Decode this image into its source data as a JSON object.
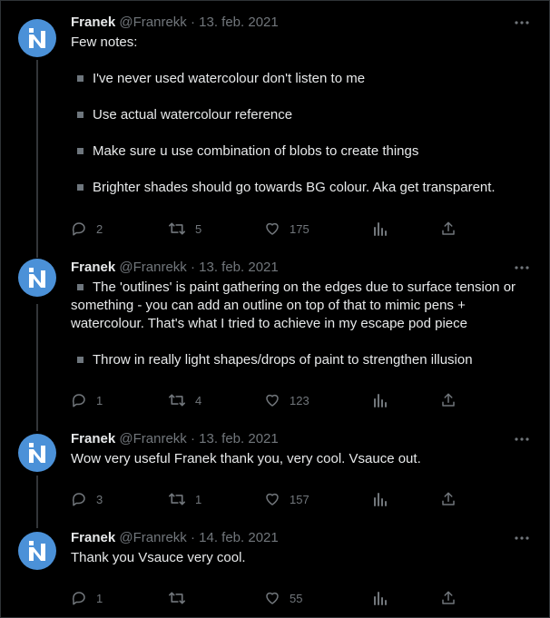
{
  "tweets": [
    {
      "name": "Franek",
      "handle": "@Franrekk",
      "sep": "·",
      "date": "13. feb. 2021",
      "paragraphs": [
        {
          "type": "text",
          "text": "Few notes:"
        },
        {
          "type": "bullet",
          "text": "I've never used watercolour don't listen to me"
        },
        {
          "type": "bullet",
          "text": "Use actual watercolour reference"
        },
        {
          "type": "bullet",
          "text": "Make sure u use combination of blobs to create things"
        },
        {
          "type": "bullet",
          "text": "Brighter shades should go towards BG colour. Aka get transparent."
        }
      ],
      "replies": "2",
      "retweets": "5",
      "likes": "175"
    },
    {
      "name": "Franek",
      "handle": "@Franrekk",
      "sep": "·",
      "date": "13. feb. 2021",
      "paragraphs": [
        {
          "type": "bullet",
          "text": "The 'outlines' is paint gathering on the edges due to surface tension or something - you can add an outline on top of that to mimic pens + watercolour. That's what I tried to achieve in my escape pod piece"
        },
        {
          "type": "bullet",
          "text": "Throw in really light shapes/drops of paint to strengthen illusion"
        }
      ],
      "replies": "1",
      "retweets": "4",
      "likes": "123"
    },
    {
      "name": "Franek",
      "handle": "@Franrekk",
      "sep": "·",
      "date": "13. feb. 2021",
      "paragraphs": [
        {
          "type": "text",
          "text": "Wow very useful Franek thank you, very cool. Vsauce out."
        }
      ],
      "replies": "3",
      "retweets": "1",
      "likes": "157"
    },
    {
      "name": "Franek",
      "handle": "@Franrekk",
      "sep": "·",
      "date": "14. feb. 2021",
      "paragraphs": [
        {
          "type": "text",
          "text": "Thank you Vsauce very cool."
        }
      ],
      "replies": "1",
      "retweets": "",
      "likes": "55"
    }
  ],
  "icons": {
    "avatar": "stylized-n-logo-icon",
    "more": "more-horizontal-icon",
    "reply": "reply-bubble-icon",
    "retweet": "retweet-icon",
    "like": "heart-icon",
    "views": "analytics-icon",
    "share": "share-icon"
  },
  "colors": {
    "background": "#000000",
    "text": "#e7e9ea",
    "muted": "#71767b",
    "avatar": "#4b91d8",
    "thread_line": "#333639"
  }
}
